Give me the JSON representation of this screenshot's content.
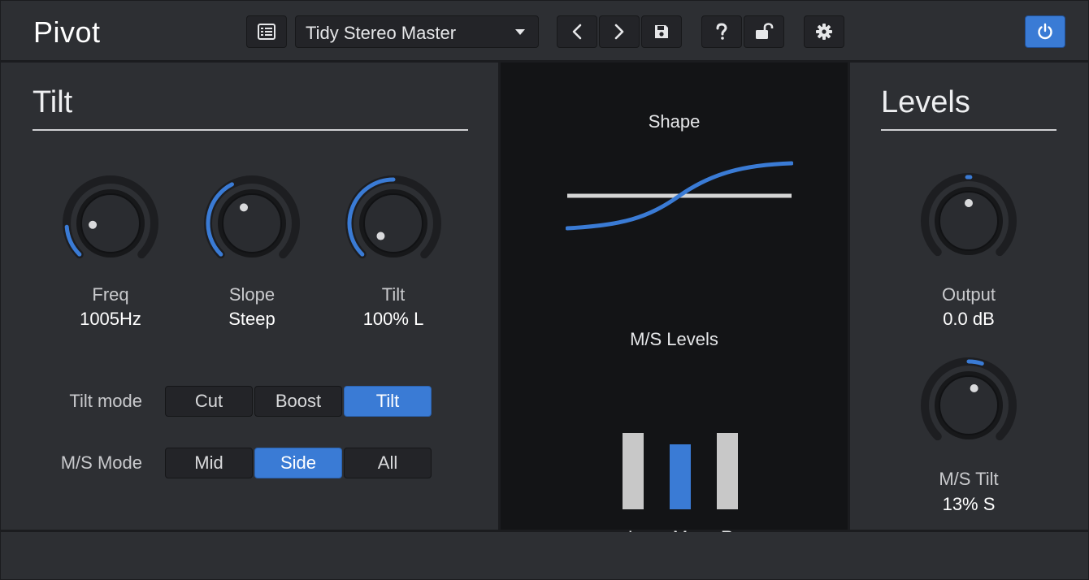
{
  "app": {
    "title": "Pivot"
  },
  "header": {
    "preset_name": "Tidy Stereo Master",
    "buttons": [
      "list-icon",
      "chevron-left-icon",
      "chevron-right-icon",
      "save-icon",
      "help-icon",
      "unlock-icon",
      "gear-icon",
      "power-icon"
    ],
    "accent_color": "#3a7bd5"
  },
  "tilt": {
    "title": "Tilt",
    "knobs": [
      {
        "label": "Freq",
        "value": "1005Hz",
        "level": 0.15
      },
      {
        "label": "Slope",
        "value": "Steep",
        "level": 0.4
      },
      {
        "label": "Tilt",
        "value": "100% L",
        "level": 0.0,
        "bipolar": true
      }
    ],
    "tilt_mode": {
      "label": "Tilt mode",
      "options": [
        "Cut",
        "Boost",
        "Tilt"
      ],
      "selected": "Tilt"
    },
    "ms_mode": {
      "label": "M/S Mode",
      "options": [
        "Mid",
        "Side",
        "All"
      ],
      "selected": "Side"
    }
  },
  "center": {
    "shape_label": "Shape",
    "ms_levels_label": "M/S Levels",
    "meters": [
      {
        "label": "L",
        "color": "#c8c8c8"
      },
      {
        "label": "M",
        "color": "#3a7bd5"
      },
      {
        "label": "R",
        "color": "#c8c8c8"
      }
    ]
  },
  "levels": {
    "title": "Levels",
    "output": {
      "label": "Output",
      "value": "0.0 dB",
      "level": 0.5,
      "bipolar": true
    },
    "ms_tilt": {
      "label": "M/S Tilt",
      "value": "13% S",
      "level": 0.565,
      "bipolar": true
    }
  }
}
